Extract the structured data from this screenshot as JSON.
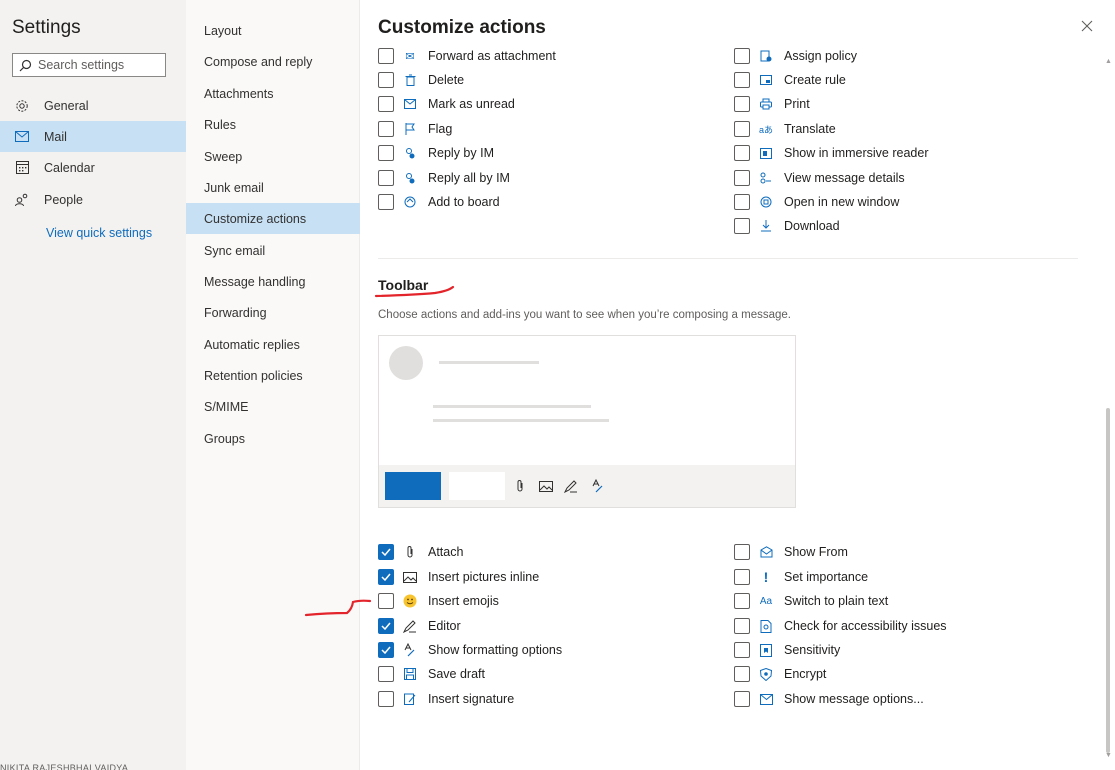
{
  "left": {
    "title": "Settings",
    "search_placeholder": "Search settings",
    "items": [
      {
        "label": "General"
      },
      {
        "label": "Mail"
      },
      {
        "label": "Calendar"
      },
      {
        "label": "People"
      }
    ],
    "view_quick": "View quick settings",
    "account": "NIKITA RAJESHBHAI VAIDYA ..."
  },
  "mid": {
    "items": [
      "Layout",
      "Compose and reply",
      "Attachments",
      "Rules",
      "Sweep",
      "Junk email",
      "Customize actions",
      "Sync email",
      "Message handling",
      "Forwarding",
      "Automatic replies",
      "Retention policies",
      "S/MIME",
      "Groups"
    ]
  },
  "main": {
    "title": "Customize actions",
    "message_actions_left": [
      {
        "label": "Forward as attachment",
        "icon": "forward-icon",
        "checked": false
      },
      {
        "label": "Delete",
        "icon": "trash-icon",
        "checked": false
      },
      {
        "label": "Mark as unread",
        "icon": "envelope-icon",
        "checked": false
      },
      {
        "label": "Flag",
        "icon": "flag-icon",
        "checked": false
      },
      {
        "label": "Reply by IM",
        "icon": "im-icon",
        "checked": false
      },
      {
        "label": "Reply all by IM",
        "icon": "im-icon",
        "checked": false
      },
      {
        "label": "Add to board",
        "icon": "board-icon",
        "checked": false
      }
    ],
    "message_actions_right": [
      {
        "label": "Assign policy",
        "icon": "policy-icon",
        "checked": false
      },
      {
        "label": "Create rule",
        "icon": "rule-icon",
        "checked": false
      },
      {
        "label": "Print",
        "icon": "print-icon",
        "checked": false
      },
      {
        "label": "Translate",
        "icon": "translate-icon",
        "checked": false
      },
      {
        "label": "Show in immersive reader",
        "icon": "reader-icon",
        "checked": false
      },
      {
        "label": "View message details",
        "icon": "details-icon",
        "checked": false
      },
      {
        "label": "Open in new window",
        "icon": "new-window-icon",
        "checked": false
      },
      {
        "label": "Download",
        "icon": "download-icon",
        "checked": false
      }
    ],
    "toolbar": {
      "heading": "Toolbar",
      "description": "Choose actions and add-ins you want to see when you’re composing a message.",
      "left": [
        {
          "label": "Attach",
          "icon": "paperclip-icon",
          "checked": true
        },
        {
          "label": "Insert pictures inline",
          "icon": "picture-icon",
          "checked": true
        },
        {
          "label": "Insert emojis",
          "icon": "emoji-icon",
          "checked": false
        },
        {
          "label": "Editor",
          "icon": "editor-pen-icon",
          "checked": true
        },
        {
          "label": "Show formatting options",
          "icon": "format-icon",
          "checked": true
        },
        {
          "label": "Save draft",
          "icon": "save-icon",
          "checked": false
        },
        {
          "label": "Insert signature",
          "icon": "signature-icon",
          "checked": false
        }
      ],
      "right": [
        {
          "label": "Show From",
          "icon": "show-from-icon",
          "checked": false
        },
        {
          "label": "Set importance",
          "icon": "importance-icon",
          "checked": false
        },
        {
          "label": "Switch to plain text",
          "icon": "plain-text-icon",
          "checked": false
        },
        {
          "label": "Check for accessibility issues",
          "icon": "accessibility-icon",
          "checked": false
        },
        {
          "label": "Sensitivity",
          "icon": "sensitivity-icon",
          "checked": false
        },
        {
          "label": "Encrypt",
          "icon": "encrypt-icon",
          "checked": false
        },
        {
          "label": "Show message options...",
          "icon": "message-options-icon",
          "checked": false
        }
      ]
    }
  },
  "colors": {
    "accent": "#0f6cbd",
    "selected_bg": "#c7e0f4",
    "annotation_red": "#e3242b"
  }
}
